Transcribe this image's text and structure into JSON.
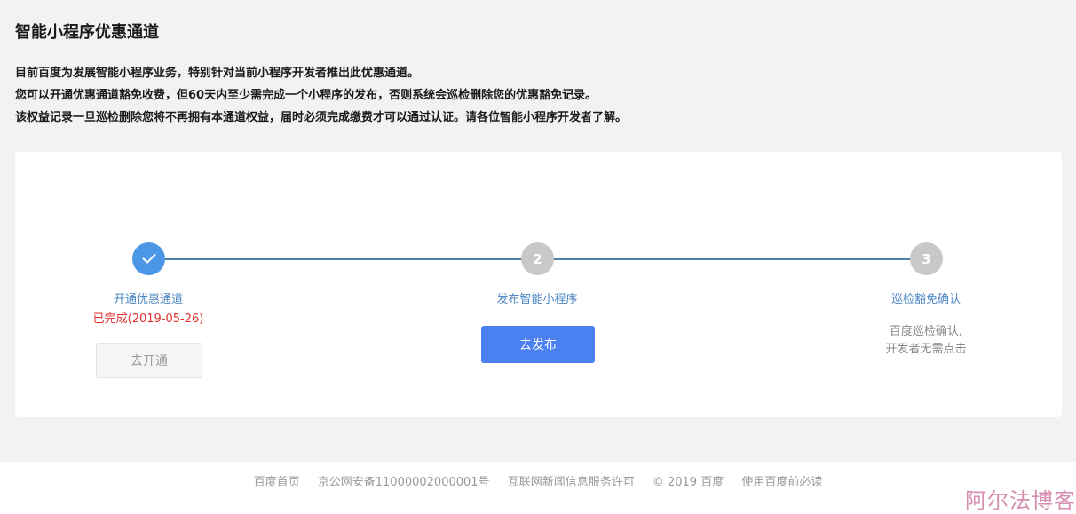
{
  "page": {
    "title": "智能小程序优惠通道",
    "intro": [
      "目前百度为发展智能小程序业务，特别针对当前小程序开发者推出此优惠通道。",
      "您可以开通优惠通道豁免收费，但60天内至少需完成一个小程序的发布，否则系统会巡检删除您的优惠豁免记录。",
      "该权益记录一旦巡检删除您将不再拥有本通道权益，届时必须完成缴费才可以通过认证。请各位智能小程序开发者了解。"
    ]
  },
  "steps": [
    {
      "icon": "check-icon",
      "label": "开通优惠通道",
      "status": "已完成(2019-05-26)",
      "button": "去开通"
    },
    {
      "number": "2",
      "label": "发布智能小程序",
      "button": "去发布"
    },
    {
      "number": "3",
      "label": "巡检豁免确认",
      "desc_line1": "百度巡检确认,",
      "desc_line2": "开发者无需点击"
    }
  ],
  "footer": {
    "links": [
      "百度首页",
      "京公网安备11000002000001号",
      "互联网新闻信息服务许可",
      "© 2019 百度",
      "使用百度前必读"
    ]
  },
  "watermark": "阿尔法博客",
  "colors": {
    "accent": "#4a80f0",
    "done": "#4c96e6",
    "error": "#e0322f",
    "link": "#4d86c3"
  }
}
